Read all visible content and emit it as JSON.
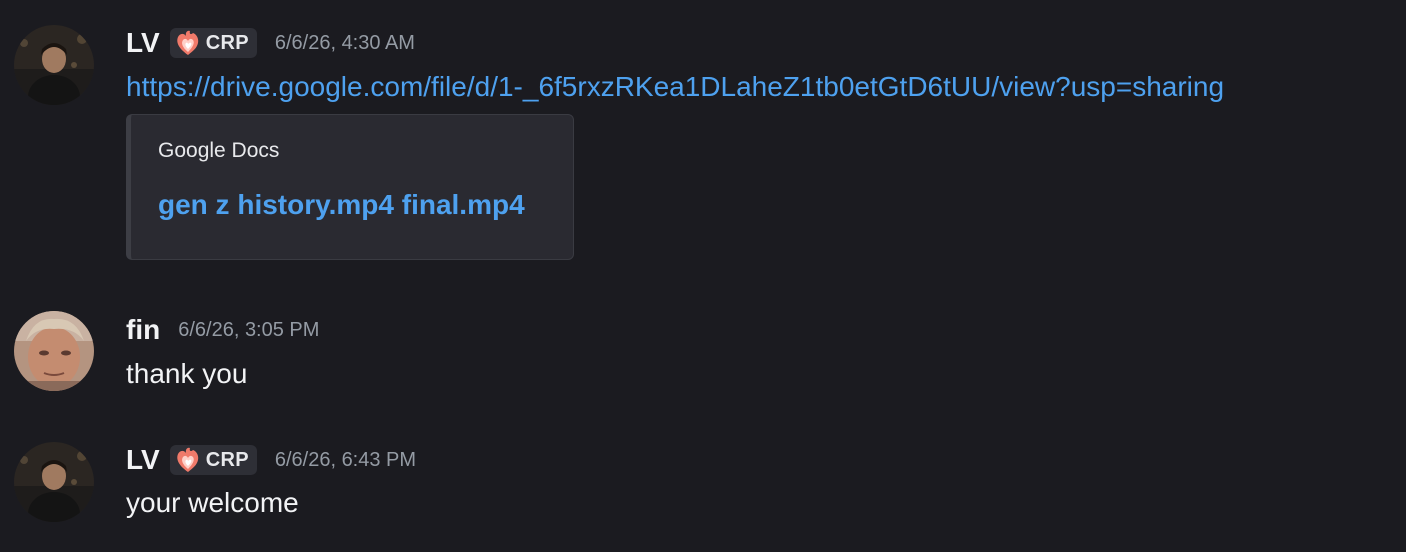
{
  "messages": [
    {
      "username": "LV",
      "role": "CRP",
      "role_icon": "fire-heart-icon",
      "timestamp": "6/6/26, 4:30 AM",
      "link": "https://drive.google.com/file/d/1-_6f5rxzRKea1DLaheZ1tb0etGtD6tUU/view?usp=sharing",
      "embed": {
        "provider": "Google Docs",
        "title": "gen z history.mp4 final.mp4"
      }
    },
    {
      "username": "fin",
      "timestamp": "6/6/26, 3:05 PM",
      "text": "thank you"
    },
    {
      "username": "LV",
      "role": "CRP",
      "role_icon": "fire-heart-icon",
      "timestamp": "6/6/26, 6:43 PM",
      "text": "your welcome"
    }
  ],
  "colors": {
    "background": "#1b1b20",
    "link": "#4ea1ef",
    "timestamp": "#949ba4",
    "embed_background": "#2a2a31"
  }
}
